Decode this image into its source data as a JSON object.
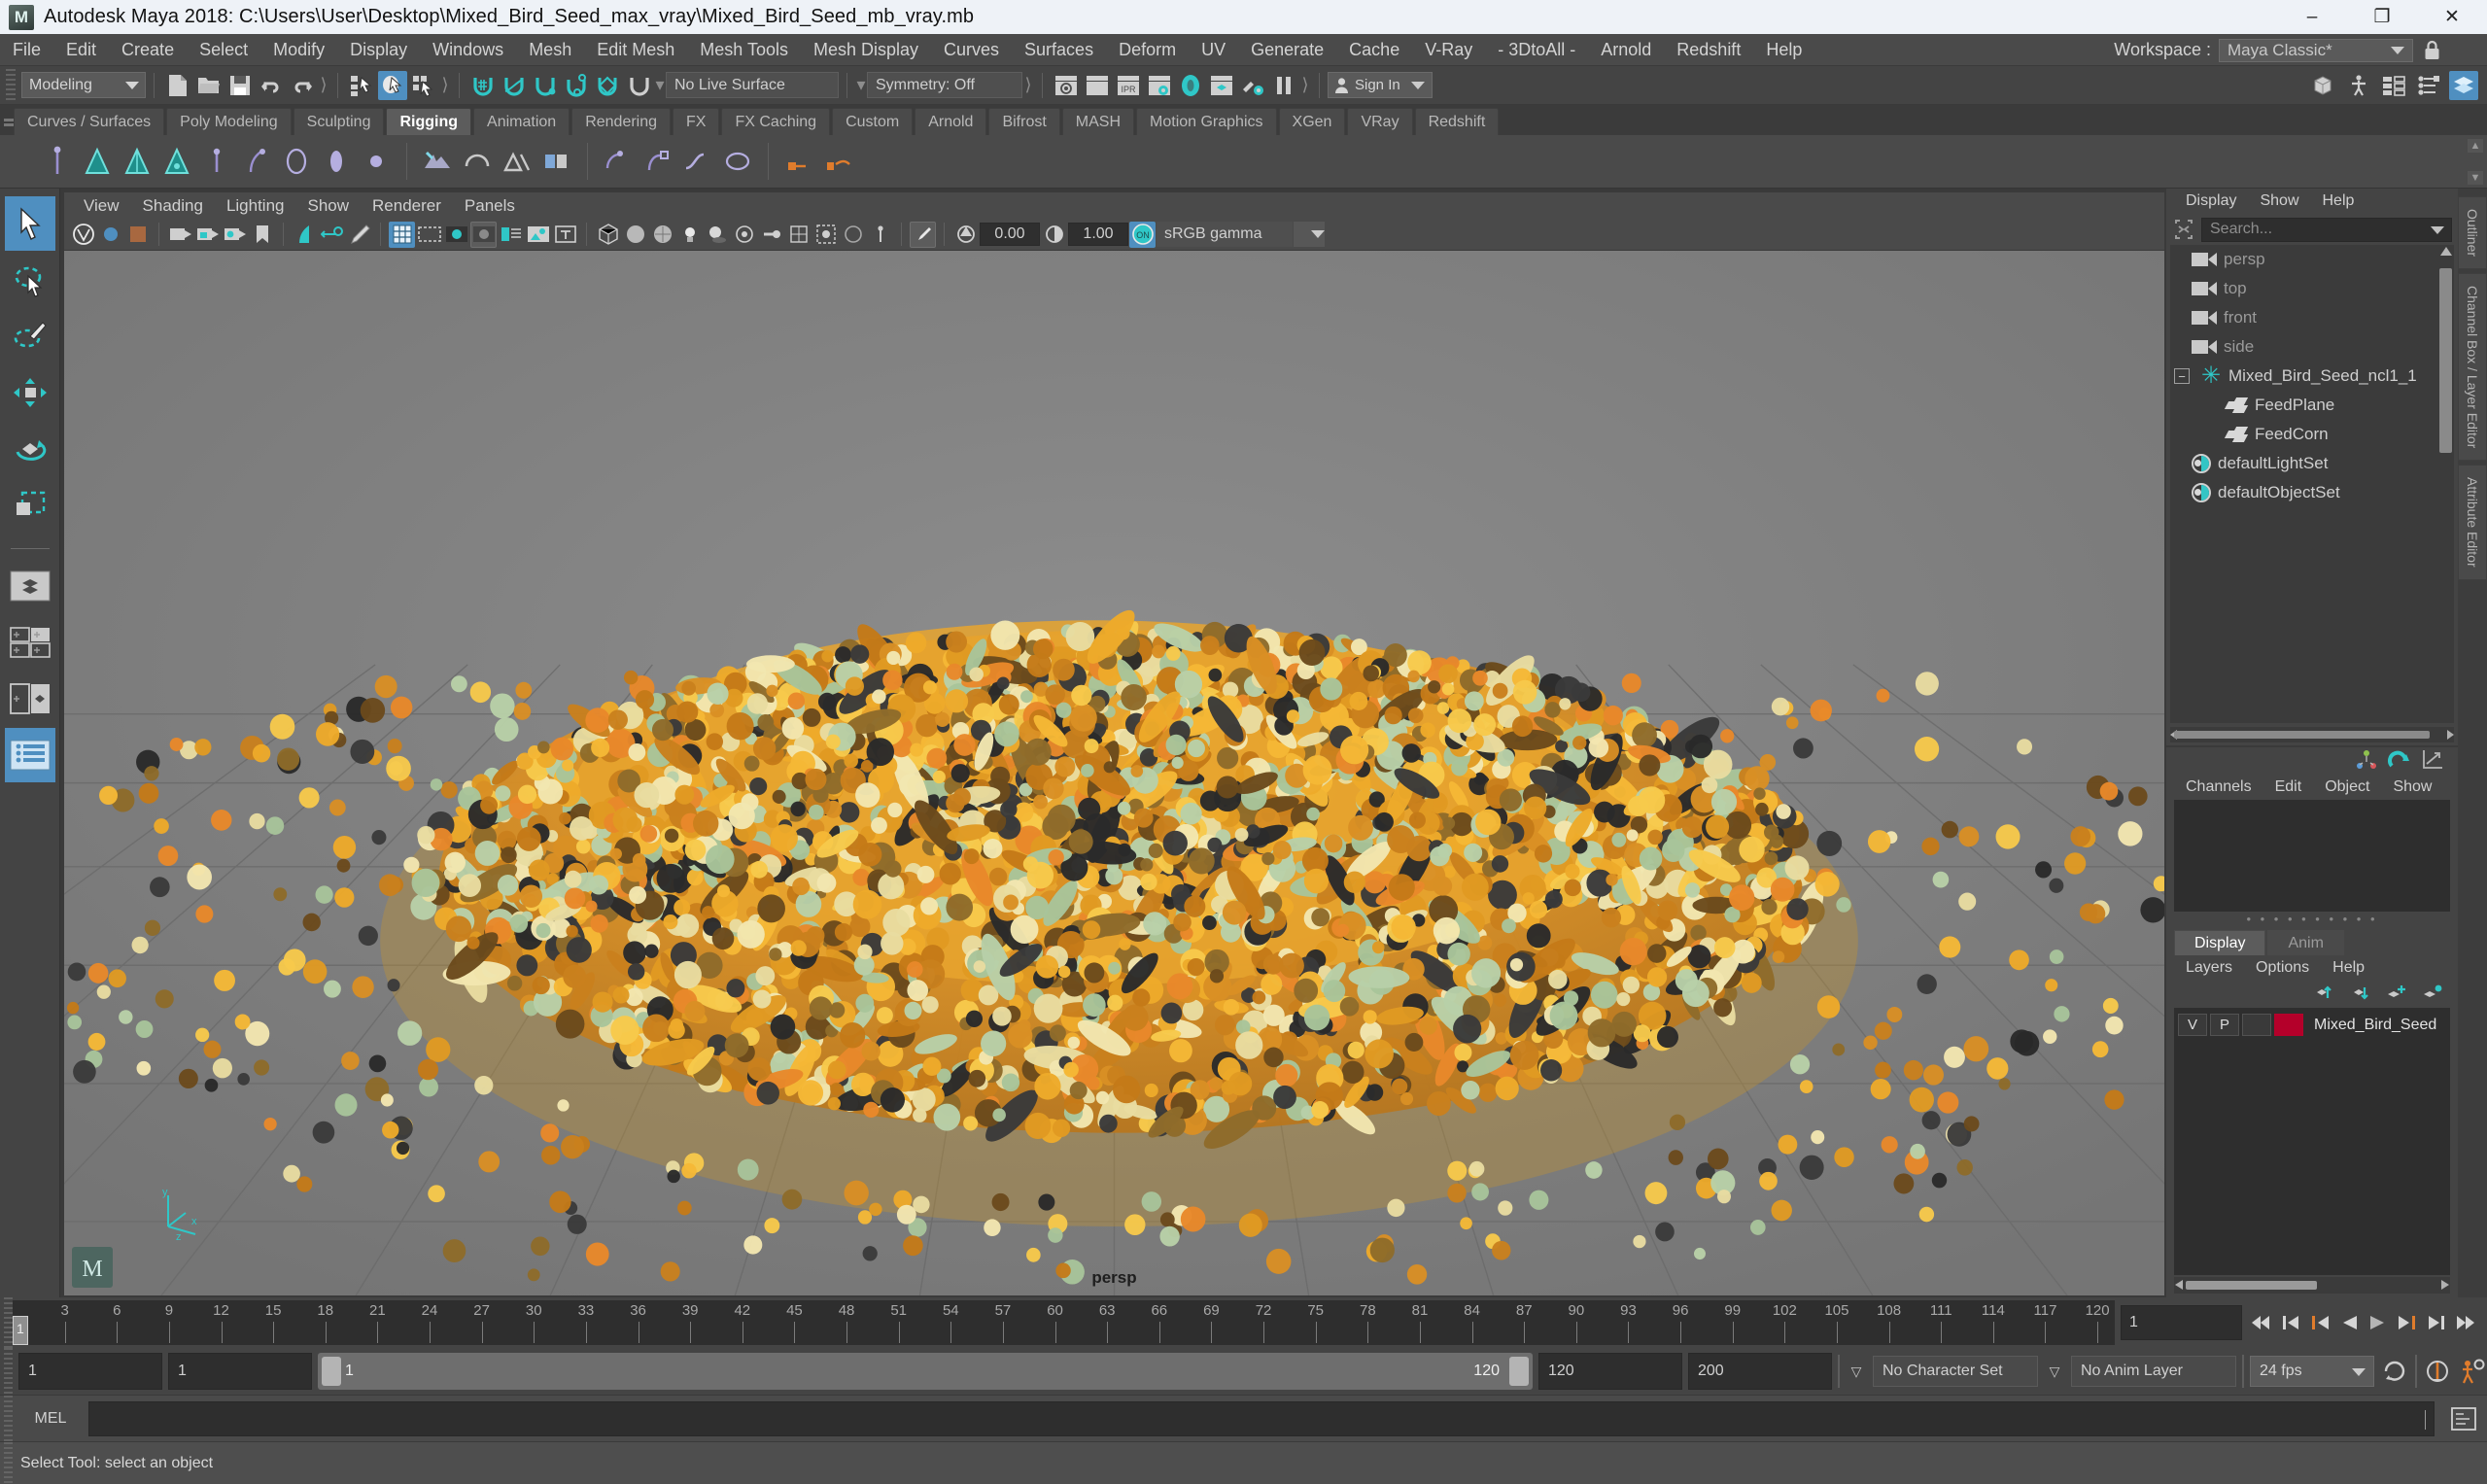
{
  "window": {
    "title": "Autodesk Maya 2018: C:\\Users\\User\\Desktop\\Mixed_Bird_Seed_max_vray\\Mixed_Bird_Seed_mb_vray.mb",
    "logo_text": "M",
    "minimize": "–",
    "maximize": "❐",
    "close": "✕"
  },
  "menubar": {
    "items": [
      "File",
      "Edit",
      "Create",
      "Select",
      "Modify",
      "Display",
      "Windows",
      "Mesh",
      "Edit Mesh",
      "Mesh Tools",
      "Mesh Display",
      "Curves",
      "Surfaces",
      "Deform",
      "UV",
      "Generate",
      "Cache",
      "V-Ray",
      "- 3DtoAll -",
      "Arnold",
      "Redshift",
      "Help"
    ],
    "workspace_label": "Workspace :",
    "workspace_value": "Maya Classic*",
    "lock_icon": "lock-icon"
  },
  "statusline": {
    "menu_set": "Modeling",
    "no_live_surface": "No Live Surface",
    "symmetry": "Symmetry: Off",
    "sign_in": "Sign In",
    "icons": {
      "new_scene": "new-scene-icon",
      "open_scene": "open-scene-icon",
      "save_scene": "save-scene-icon",
      "undo": "undo-icon",
      "redo": "redo-icon",
      "select_hierarchy": "select-by-hierarchy-icon",
      "select_object": "select-by-object-icon",
      "select_component": "select-by-component-icon",
      "snap_grid": "snap-to-grid-icon",
      "snap_curve": "snap-to-curve-icon",
      "snap_point": "snap-to-point-icon",
      "snap_projected": "snap-to-projected-center-icon",
      "snap_view_plane": "snap-to-view-plane-icon",
      "make_live": "make-live-icon",
      "render_current": "render-current-frame-icon",
      "render_sequence": "render-sequence-icon",
      "ipr": "ipr-render-icon",
      "render_settings": "render-settings-icon",
      "render_view": "render-view-icon",
      "hypershade": "hypershade-icon",
      "light_settings": "light-settings-icon",
      "pause": "pause-icon"
    }
  },
  "shelf": {
    "tabs": [
      "Curves / Surfaces",
      "Poly Modeling",
      "Sculpting",
      "Rigging",
      "Animation",
      "Rendering",
      "FX",
      "FX Caching",
      "Custom",
      "Arnold",
      "Bifrost",
      "MASH",
      "Motion Graphics",
      "XGen",
      "VRay",
      "Redshift"
    ],
    "active_tab": "Rigging",
    "buttons": [
      "create-joint-icon",
      "create-ik-handle-icon",
      "create-ik-spline-icon",
      "create-ik-spring-icon",
      "insert-joint-icon",
      "mirror-joint-icon",
      "skeleton-icon",
      "quick-rig-icon",
      "bind-skin-icon",
      "paint-weights-icon",
      "interactive-bind-icon",
      "smooth-bind-icon",
      "create-cluster-icon",
      "lattice-icon",
      "wire-tool-icon",
      "wrap-icon",
      "blend-shape-icon",
      "soft-modification-icon",
      "constraint-parent-icon",
      "constraint-point-icon"
    ]
  },
  "toolbox": {
    "tools": [
      {
        "name": "select-tool",
        "selected": true
      },
      {
        "name": "lasso-select-tool",
        "selected": false
      },
      {
        "name": "paint-select-tool",
        "selected": false
      },
      {
        "name": "move-tool",
        "selected": false
      },
      {
        "name": "rotate-tool",
        "selected": false
      },
      {
        "name": "scale-tool",
        "selected": false
      }
    ],
    "layouts": [
      {
        "name": "single-perspective-view-layout",
        "selected": false
      },
      {
        "name": "four-view-layout",
        "selected": false
      },
      {
        "name": "two-pane-layout",
        "selected": false
      },
      {
        "name": "outliner-persp-layout",
        "selected": true
      }
    ]
  },
  "viewport": {
    "menus": [
      "View",
      "Shading",
      "Lighting",
      "Show",
      "Renderer",
      "Panels"
    ],
    "camera_label": "persp",
    "exposure": "0.00",
    "gamma": "1.00",
    "color_management_toggle": "ON",
    "color_profile": "sRGB gamma",
    "axis": {
      "x": "x",
      "y": "y",
      "z": "z"
    },
    "toolbar_icons": [
      "vray-vfb-icon",
      "vray-settings-icon",
      "vray-render-icon",
      "select-camera-icon",
      "lock-camera-icon",
      "camera-attributes-icon",
      "bookmark-icon",
      "image-plane-icon",
      "two-d-pan-zoom-icon",
      "grease-pencil-icon",
      "grid-toggle-icon",
      "film-gate-icon",
      "resolution-gate-icon",
      "gate-mask-icon",
      "film-origin-icon",
      "safe-action-icon",
      "safe-title-icon",
      "wireframe-icon",
      "smooth-shade-all-icon",
      "shaded-textured-icon",
      "use-all-lights-icon",
      "shadows-icon",
      "ambient-occlusion-icon",
      "motion-blur-icon",
      "multisample-icon",
      "isolate-select-icon",
      "xray-icon",
      "xray-joints-icon",
      "exposure-icon",
      "contrast-icon"
    ]
  },
  "outliner": {
    "panel_title": "Outliner",
    "menus": [
      "Display",
      "Show",
      "Help"
    ],
    "search_placeholder": "Search...",
    "search_icon": "outliner-search-icon",
    "items": [
      {
        "label": "persp",
        "icon": "camera-icon",
        "indent": 0,
        "dim": true
      },
      {
        "label": "top",
        "icon": "camera-icon",
        "indent": 0,
        "dim": true
      },
      {
        "label": "front",
        "icon": "camera-icon",
        "indent": 0,
        "dim": true
      },
      {
        "label": "side",
        "icon": "camera-icon",
        "indent": 0,
        "dim": true
      },
      {
        "label": "Mixed_Bird_Seed_ncl1_1",
        "icon": "nucleus-icon",
        "indent": 0,
        "dim": false,
        "expanded": true
      },
      {
        "label": "FeedPlane",
        "icon": "mesh-icon",
        "indent": 1,
        "dim": false
      },
      {
        "label": "FeedCorn",
        "icon": "mesh-icon",
        "indent": 1,
        "dim": false
      },
      {
        "label": "defaultLightSet",
        "icon": "set-icon",
        "indent": 0,
        "dim": false
      },
      {
        "label": "defaultObjectSet",
        "icon": "set-icon",
        "indent": 0,
        "dim": false
      }
    ]
  },
  "channelbox": {
    "panel_title": "Channel Box / Layer Editor",
    "attribute_editor_tab": "Attribute Editor",
    "menus": [
      "Channels",
      "Edit",
      "Object",
      "Show"
    ],
    "top_icons": [
      "show-channel-box-icon",
      "show-attribute-editor-icon",
      "show-graph-editor-icon"
    ],
    "layer_tabs": [
      {
        "label": "Display",
        "active": true
      },
      {
        "label": "Anim",
        "active": false
      }
    ],
    "layer_menus": [
      "Layers",
      "Options",
      "Help"
    ],
    "layer_buttons": [
      "move-layer-up-icon",
      "move-layer-down-icon",
      "create-new-layer-icon",
      "create-layer-from-selected-icon"
    ],
    "layers": [
      {
        "visibility": "V",
        "playback": "P",
        "shading": "",
        "color": "#b4002a",
        "name": "Mixed_Bird_Seed"
      }
    ]
  },
  "timeline": {
    "ticks": [
      3,
      6,
      9,
      12,
      15,
      18,
      21,
      24,
      27,
      30,
      33,
      36,
      39,
      42,
      45,
      48,
      51,
      54,
      57,
      60,
      63,
      66,
      69,
      72,
      75,
      78,
      81,
      84,
      87,
      90,
      93,
      96,
      99,
      102,
      105,
      108,
      111,
      114,
      117,
      120
    ],
    "current_frame": "1",
    "playhead_label": "1",
    "current_frame_field": "1",
    "playback_buttons": [
      "go-to-start-icon",
      "step-back-keyframe-icon",
      "step-back-frame-icon",
      "play-backwards-icon",
      "play-forwards-icon",
      "step-forward-frame-icon",
      "step-forward-keyframe-icon",
      "go-to-end-icon"
    ]
  },
  "rangeslider": {
    "anim_start": "1",
    "range_start": "1",
    "slider_start_label": "1",
    "slider_end_label": "120",
    "range_end": "120",
    "anim_end": "200",
    "character_set": "No Character Set",
    "anim_layer": "No Anim Layer",
    "fps": "24 fps",
    "icons": [
      "auto-key-icon",
      "animation-preferences-icon",
      "playback-loop-icon"
    ]
  },
  "command": {
    "language_label": "MEL",
    "input_value": "",
    "script_editor_icon": "script-editor-icon"
  },
  "statusbar": {
    "help_text": "Select Tool: select an object",
    "right_icon": "range-slider-toggle-icon"
  },
  "colors": {
    "accent_blue": "#4f8fc0",
    "accent_teal": "#2fc7c7",
    "accent_orange": "#e07c2c",
    "panel_bg": "#444444",
    "dark_field": "#2e2e2e",
    "viewport_bg": "#7d7d7d",
    "layer_color": "#b4002a"
  }
}
